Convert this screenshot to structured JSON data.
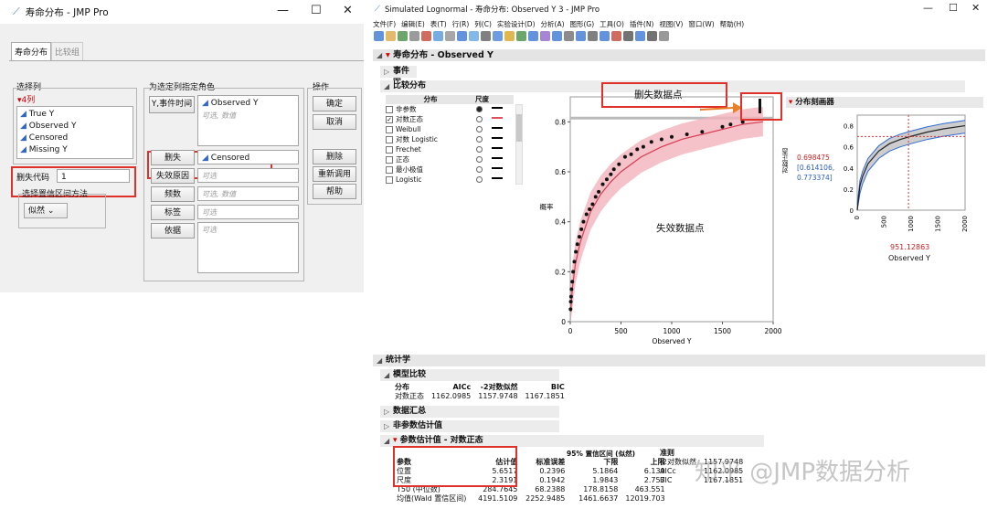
{
  "left": {
    "title": "寿命分布 - JMP Pro",
    "tabs": [
      "寿命分布",
      "比较组"
    ],
    "select_cols_label": "选择列",
    "cols_count": "▾4列",
    "columns": [
      "True Y",
      "Observed Y",
      "Censored",
      "Missing Y"
    ],
    "censor_code_label": "删失代码",
    "censor_code_value": "1",
    "ci_method_label": "选择置信区间方法",
    "ci_method_value": "似然",
    "roles_label": "为选定列指定角色",
    "roles": [
      {
        "label": "Y,事件时间",
        "value": "Observed Y",
        "hint": "可选, 数值"
      },
      {
        "label": "删失",
        "value": "Censored"
      },
      {
        "label": "失效原因",
        "value": "",
        "hint": "可选"
      },
      {
        "label": "频数",
        "value": "",
        "hint": "可选, 数值"
      },
      {
        "label": "标签",
        "value": "",
        "hint": "可选"
      },
      {
        "label": "依据",
        "value": "",
        "hint": "可选"
      }
    ],
    "actions_label": "操作",
    "actions": [
      "确定",
      "取消",
      "删除",
      "重新调用",
      "帮助"
    ]
  },
  "right": {
    "title": "Simulated Lognormal - 寿命分布: Observed Y 3 - JMP Pro",
    "menu": [
      "文件(F)",
      "编辑(E)",
      "表(T)",
      "行(R)",
      "列(C)",
      "实验设计(D)",
      "分析(A)",
      "图形(G)",
      "工具(O)",
      "插件(N)",
      "视图(V)",
      "窗口(W)",
      "帮助(H)"
    ],
    "report_title": "寿命分布 - Observed Y",
    "event_plot": "事件图",
    "compare_dist": "比较分布",
    "dist_header": "分布",
    "scale_header": "尺度",
    "distributions": [
      "非参数",
      "对数正态",
      "Weibull",
      "对数 Logistic",
      "Frechet",
      "正态",
      "最小极值",
      "Logistic"
    ],
    "dist_checked": [
      false,
      true,
      false,
      false,
      false,
      false,
      false,
      false
    ],
    "annot_censor": "删失数据点",
    "annot_fail": "失效数据点",
    "profiler_title": "分布刻画器",
    "prof_ylabel": "对数正态",
    "prof_value": "0.698475",
    "prof_ci": "[0.614106,",
    "prof_ci2": "0.773374]",
    "prof_x_value": "951.12863",
    "prof_xlabel": "Observed Y",
    "stats": "统计学",
    "model_compare": "模型比较",
    "mc_headers": [
      "分布",
      "AICc",
      "-2对数似然",
      "BIC"
    ],
    "mc_row": [
      "对数正态",
      "1162.0985",
      "1157.9748",
      "1167.1851"
    ],
    "data_summary": "数据汇总",
    "nonparam": "非参数估计值",
    "param_est": "参数估计值 - 对数正态",
    "pe_ci_header": "95% 置信区间 (似然)",
    "pe_headers": [
      "参数",
      "估计值",
      "标准误差",
      "下限",
      "上限"
    ],
    "pe_rows": [
      [
        "位置",
        "5.6517",
        "0.2396",
        "5.1864",
        "6.139"
      ],
      [
        "尺度",
        "2.3191",
        "0.1942",
        "1.9843",
        "2.757"
      ],
      [
        "T50 (中位数)",
        "284.7645",
        "68.2388",
        "178.8158",
        "463.551"
      ],
      [
        "均值(Wald 置信区间)",
        "4191.5109",
        "2252.9485",
        "1461.6637",
        "12019.703"
      ]
    ],
    "crit_header": "准则",
    "crit_rows": [
      [
        "-2对数似然",
        "1157.9748"
      ],
      [
        "AICc",
        "1162.0985"
      ],
      [
        "BIC",
        "1167.1851"
      ]
    ],
    "watermark": "知乎 @JMP数据分析"
  },
  "chart_data": [
    {
      "type": "scatter",
      "title": "",
      "xlabel": "Observed Y",
      "ylabel": "概率",
      "xlim": [
        0,
        2000
      ],
      "ylim": [
        0,
        0.9
      ],
      "xticks": [
        0,
        500,
        1000,
        1500,
        2000
      ],
      "yticks": [
        0,
        0.2,
        0.4,
        0.6,
        0.8
      ],
      "series": [
        {
          "name": "对数正态",
          "x": [
            5,
            20,
            50,
            100,
            200,
            300,
            400,
            500,
            700,
            900,
            1100,
            1300,
            1500,
            1700,
            1900
          ],
          "y": [
            0.04,
            0.13,
            0.23,
            0.32,
            0.44,
            0.51,
            0.56,
            0.6,
            0.66,
            0.7,
            0.73,
            0.75,
            0.77,
            0.79,
            0.8
          ]
        }
      ],
      "points": {
        "x": [
          3,
          5,
          8,
          12,
          20,
          28,
          40,
          55,
          70,
          90,
          110,
          130,
          160,
          190,
          220,
          250,
          280,
          320,
          360,
          400,
          430,
          480,
          540,
          600,
          660,
          720,
          800,
          900,
          1000,
          1150,
          1300,
          1500,
          1580,
          1700
        ],
        "y": [
          0.05,
          0.08,
          0.1,
          0.13,
          0.16,
          0.2,
          0.24,
          0.28,
          0.31,
          0.34,
          0.37,
          0.4,
          0.43,
          0.45,
          0.47,
          0.5,
          0.52,
          0.55,
          0.57,
          0.59,
          0.61,
          0.63,
          0.66,
          0.67,
          0.69,
          0.7,
          0.72,
          0.73,
          0.74,
          0.75,
          0.76,
          0.78,
          0.79,
          0.8
        ]
      }
    },
    {
      "type": "line",
      "title": "",
      "xlabel": "Observed Y",
      "ylabel": "对数正态",
      "xlim": [
        0,
        2000
      ],
      "ylim": [
        0,
        0.9
      ],
      "xticks": [
        0,
        500,
        1000,
        1500,
        2000
      ],
      "yticks": [
        0,
        0.2,
        0.4,
        0.6,
        0.8
      ],
      "x": [
        0,
        50,
        100,
        200,
        400,
        600,
        800,
        1000,
        1300,
        1600,
        2000
      ],
      "y": [
        0,
        0.23,
        0.32,
        0.44,
        0.56,
        0.63,
        0.67,
        0.7,
        0.74,
        0.77,
        0.8
      ]
    }
  ]
}
